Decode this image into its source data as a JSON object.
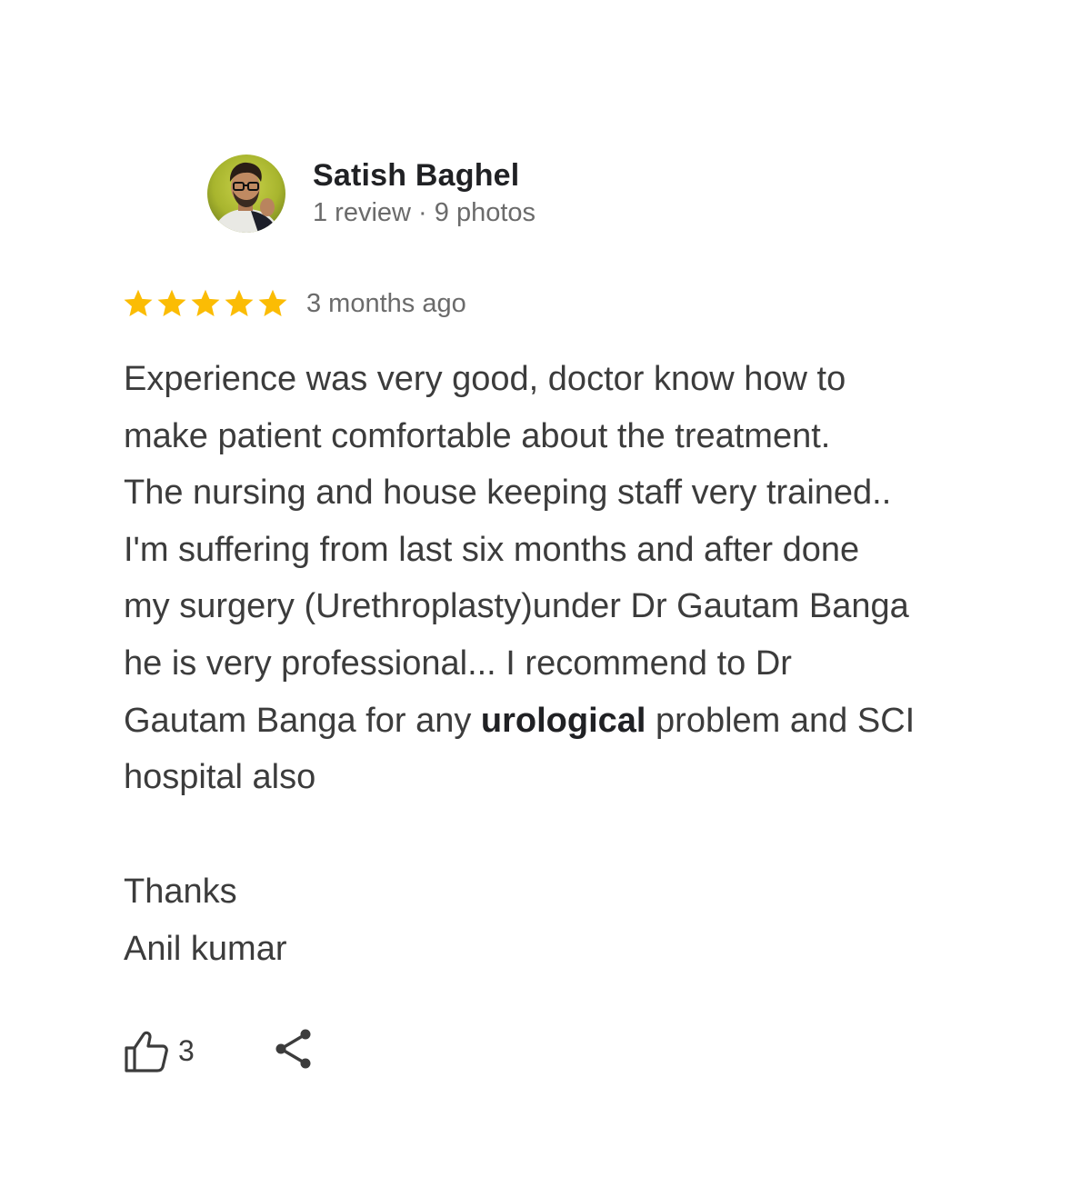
{
  "reviewer": {
    "name": "Satish Baghel",
    "meta": "1 review · 9 photos"
  },
  "rating": {
    "stars": 5,
    "max_stars": 5,
    "time_ago": "3 months ago",
    "star_color": "#fbbc04"
  },
  "review": {
    "part1": "Experience was very good, doctor know how to\nmake patient comfortable about the treatment.\nThe nursing and house keeping staff very trained..\nI'm suffering from last six months and after done\nmy surgery (Urethroplasty)under Dr Gautam Banga\nhe is very professional... I recommend to Dr\nGautam Banga for any ",
    "highlight": "urological",
    "part2": " problem and SCI\nhospital also",
    "signoff_line1": "Thanks",
    "signoff_line2": "Anil kumar"
  },
  "actions": {
    "like_icon": "thumbs-up-icon",
    "like_count": "3",
    "share_icon": "share-icon"
  }
}
